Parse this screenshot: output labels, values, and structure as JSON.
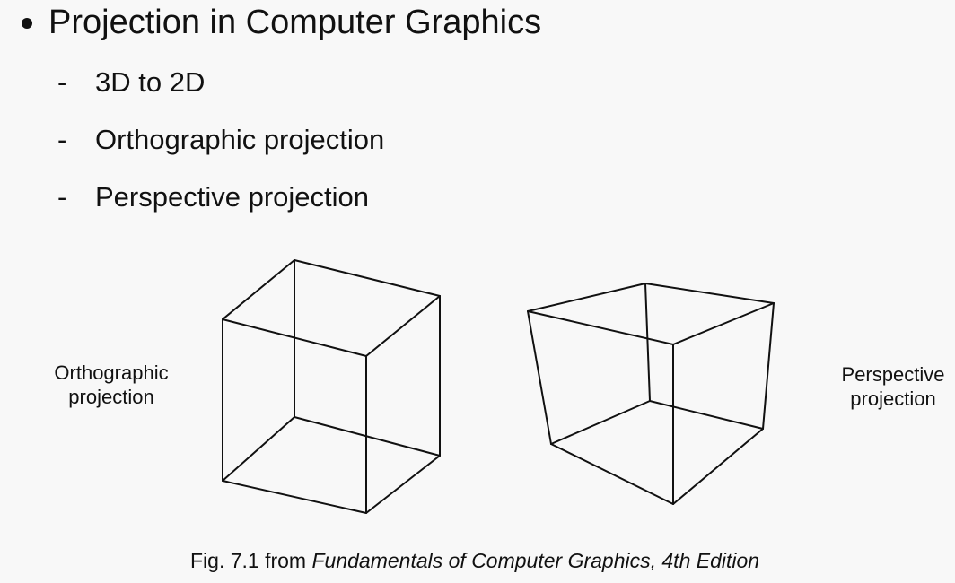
{
  "slide": {
    "title": "Projection in Computer Graphics",
    "items": [
      {
        "dash": "-",
        "label": "3D to 2D"
      },
      {
        "dash": "-",
        "label": "Orthographic projection"
      },
      {
        "dash": "-",
        "label": "Perspective projection"
      }
    ]
  },
  "figure": {
    "left_label_line1": "Orthographic",
    "left_label_line2": "projection",
    "right_label_line1": "Perspective",
    "right_label_line2": "projection",
    "caption_prefix": "Fig. 7.1 from ",
    "caption_title": "Fundamentals of Computer Graphics, 4th Edition"
  }
}
